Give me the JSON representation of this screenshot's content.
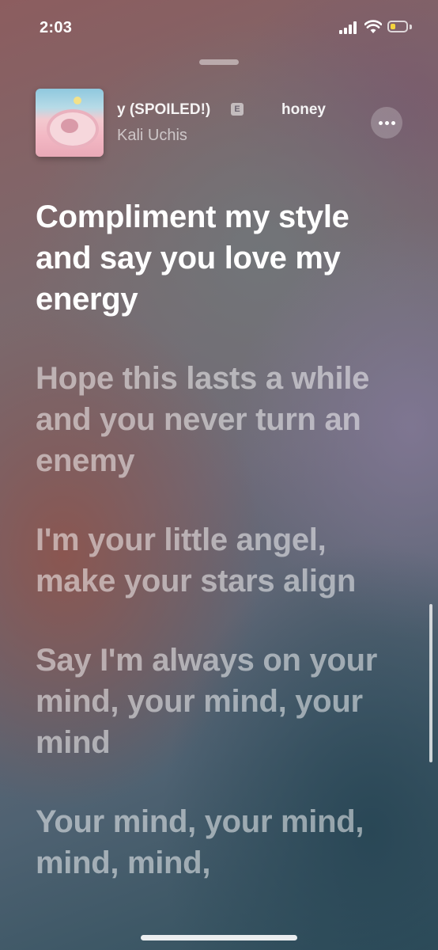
{
  "status_bar": {
    "time": "2:03",
    "battery_level": 0.35,
    "battery_color": "#f4d33c"
  },
  "now_playing": {
    "title_visible": "y (SPOILED!)",
    "explicit_badge": "E",
    "next_title_visible": "honey",
    "artist": "Kali Uchis",
    "more_icon": "ellipsis-icon"
  },
  "lyrics": [
    {
      "text": "Compliment my style and say you love my energy",
      "state": "current"
    },
    {
      "text": "Hope this lasts a while and you never turn an enemy",
      "state": "upcoming"
    },
    {
      "text": "I'm your little angel, make your stars align",
      "state": "upcoming"
    },
    {
      "text": "Say I'm always on your mind, your mind, your mind",
      "state": "upcoming"
    },
    {
      "text": "Your mind, your mind, mind, mind,",
      "state": "upcoming"
    }
  ]
}
